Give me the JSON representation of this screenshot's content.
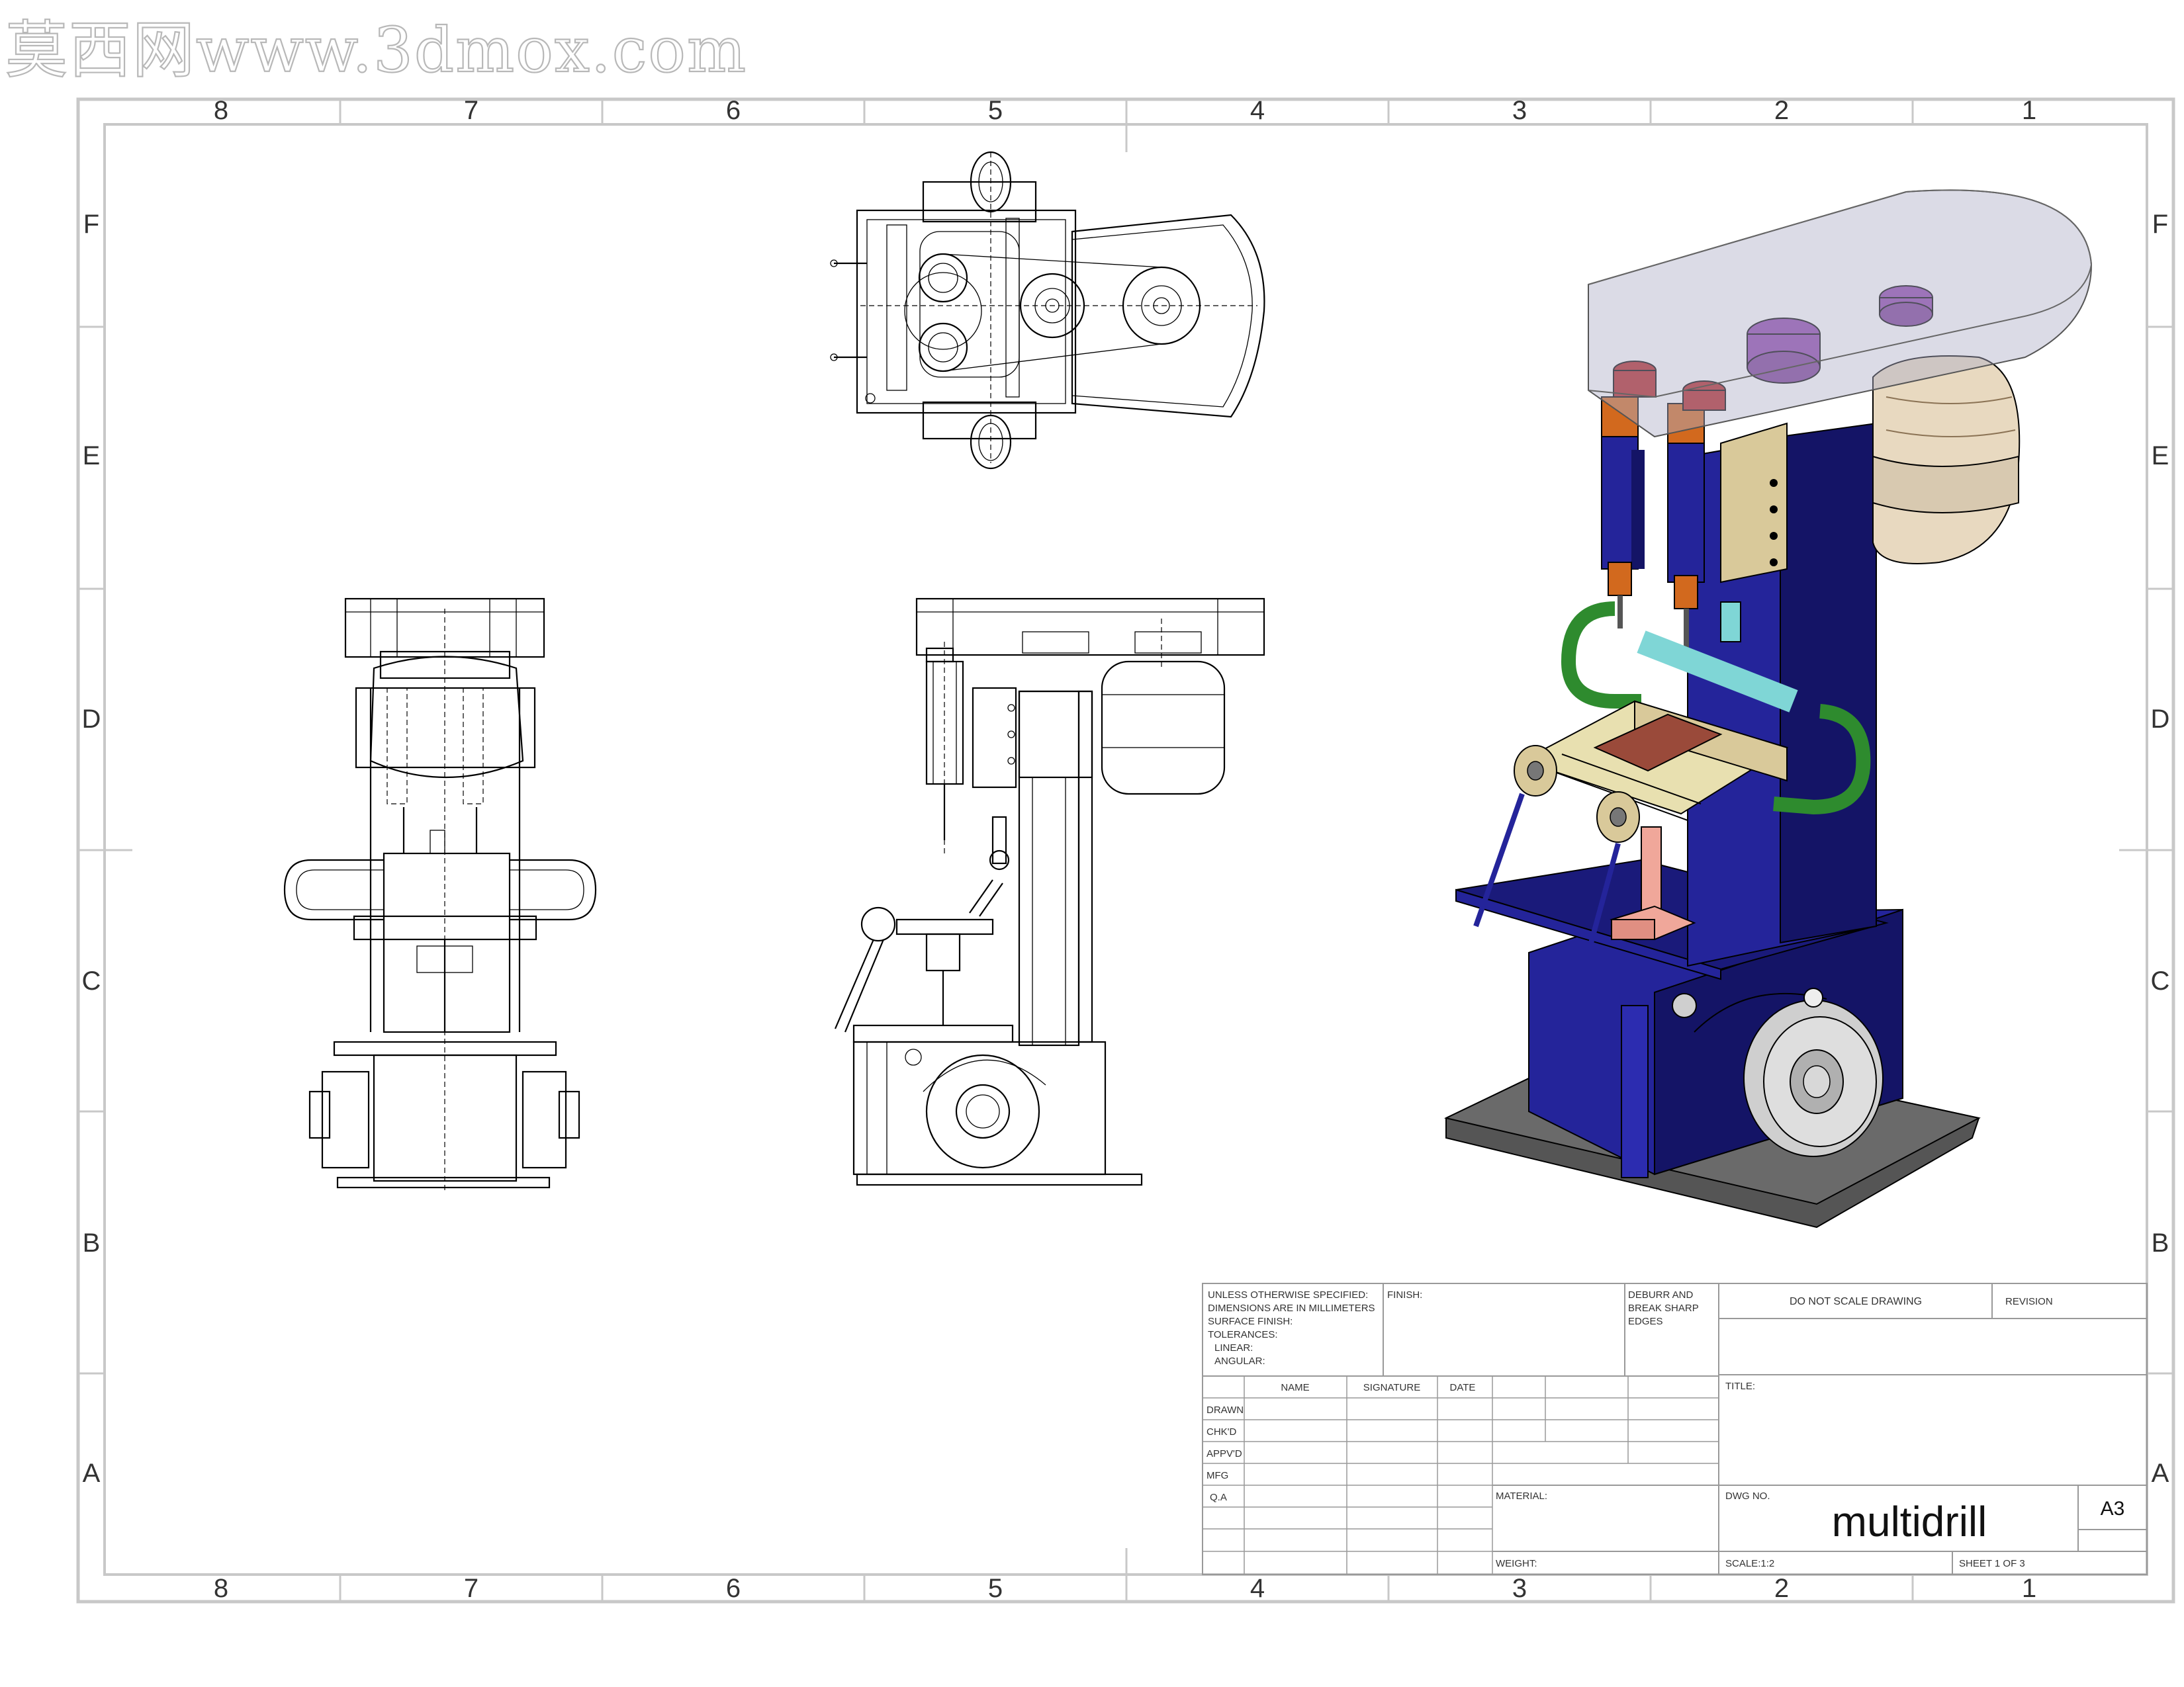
{
  "watermark": "莫西网www.3dmox.com",
  "zones": {
    "columns": [
      "8",
      "7",
      "6",
      "5",
      "4",
      "3",
      "2",
      "1"
    ],
    "rows": [
      "F",
      "E",
      "D",
      "C",
      "B",
      "A"
    ]
  },
  "title_block": {
    "notes": [
      "UNLESS OTHERWISE SPECIFIED:",
      "DIMENSIONS ARE IN MILLIMETERS",
      "SURFACE FINISH:",
      "TOLERANCES:",
      "   LINEAR:",
      "   ANGULAR:"
    ],
    "finish_label": "FINISH:",
    "deburr": [
      "DEBURR AND",
      "BREAK SHARP",
      "EDGES"
    ],
    "do_not_scale": "DO NOT SCALE DRAWING",
    "revision_label": "REVISION",
    "columns": [
      "NAME",
      "SIGNATURE",
      "DATE"
    ],
    "rows": [
      "DRAWN",
      "CHK'D",
      "APPV'D",
      "MFG",
      "Q.A"
    ],
    "title_label": "TITLE:",
    "material_label": "MATERIAL:",
    "dwg_no_label": "DWG NO.",
    "dwg_no": "multidrill",
    "size": "A3",
    "weight_label": "WEIGHT:",
    "scale": "SCALE:1:2",
    "sheet": "SHEET 1 OF 3"
  },
  "colors": {
    "frame": "#c8c8c8",
    "body_blue": "#24249a",
    "dark_blue": "#141466",
    "copper": "#d2691e",
    "purple": "#8e44ad",
    "green": "#2e8b2e",
    "cyan": "#7fd6d6",
    "tan": "#d9c99a",
    "beige": "#e8d9c0",
    "gray_plate": "#555555",
    "pink": "#f0a79a"
  }
}
